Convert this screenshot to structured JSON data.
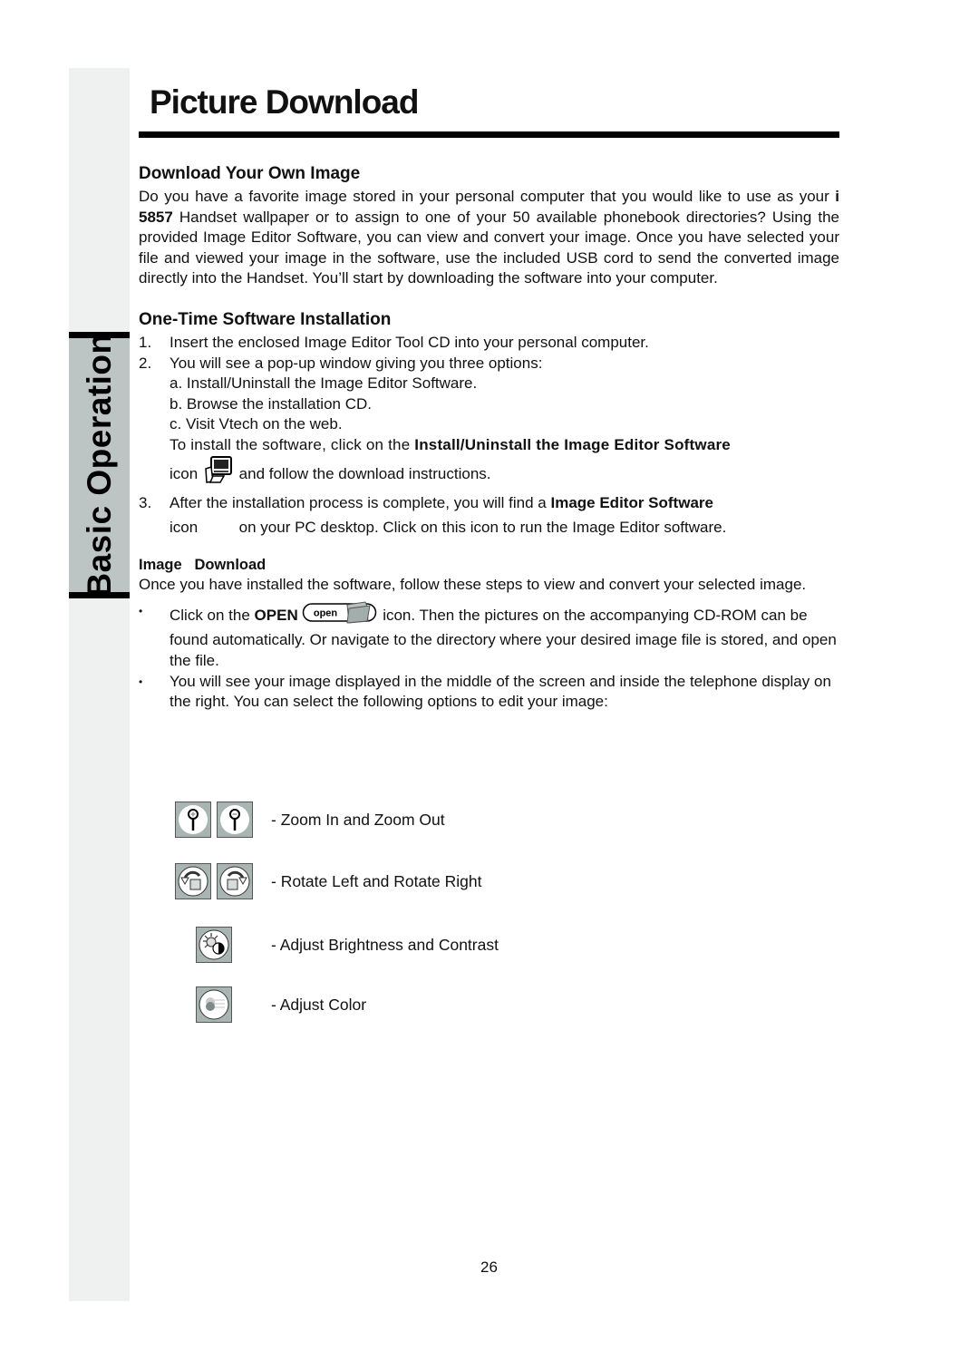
{
  "page": {
    "title": "Picture Download",
    "side_tab": "Basic Operation",
    "page_number": "26"
  },
  "section_own_image": {
    "heading": "Download Your Own Image",
    "intro_before_model": "Do you have a favorite image stored in your personal computer that you would like to use as your ",
    "model": "i 5857",
    "intro_after_model": " Handset wallpaper or to assign to one of your 50 available phonebook directories? Using the provided Image Editor Software, you can view and convert your image. Once you have selected your file and viewed your image in the software, use the included USB cord to send the converted image directly into the Handset. You’ll start by downloading the software into your computer."
  },
  "section_install": {
    "heading": "One-Time Software Installation",
    "steps": [
      {
        "num": "1.",
        "text": "Insert the enclosed Image Editor Tool CD into your personal computer."
      },
      {
        "num": "2.",
        "text": "You will see a pop-up window giving you three options:"
      },
      {
        "num": "3.",
        "text_before_bold": "After the installation process is complete, you will find a ",
        "bold": "Image Editor Software"
      }
    ],
    "options": [
      "a. Install/Uninstall the Image Editor Software.",
      "b. Browse the installation CD.",
      "c. Visit Vtech on the web."
    ],
    "install_instruction_before": "To install the software, click on the ",
    "install_instruction_bold": "Install/Uninstall the Image Editor Software",
    "icon_word": "icon",
    "install_instruction_after": "and follow the download instructions.",
    "step3_line2": "on your PC desktop. Click on this icon to run the Image Editor software.",
    "install_icon": "install-computer-icon"
  },
  "section_image_download": {
    "heading": "Image   Download",
    "intro": "Once you have installed the software, follow these steps to view and convert your selected image.",
    "bullet_char": "•",
    "bullet1_before": "Click on the ",
    "bullet1_bold": "OPEN",
    "open_button_label": "open",
    "bullet1_after": " icon. Then the pictures on the accompanying CD-ROM can be found automatically. Or navigate to the directory where your desired image file is stored, and open the file.",
    "bullet2": "You will see your image displayed in the middle of the screen and inside the telephone display on the right. You can select the following options to edit your image:"
  },
  "tools": [
    {
      "label": "- Zoom In and Zoom Out",
      "icons": [
        "zoom-in-icon",
        "zoom-out-icon"
      ]
    },
    {
      "label": "- Rotate Left and Rotate Right",
      "icons": [
        "rotate-left-icon",
        "rotate-right-icon"
      ]
    },
    {
      "label": "- Adjust Brightness and Contrast",
      "icons": [
        "brightness-contrast-icon"
      ]
    },
    {
      "label": "- Adjust Color",
      "icons": [
        "adjust-color-icon"
      ]
    }
  ]
}
